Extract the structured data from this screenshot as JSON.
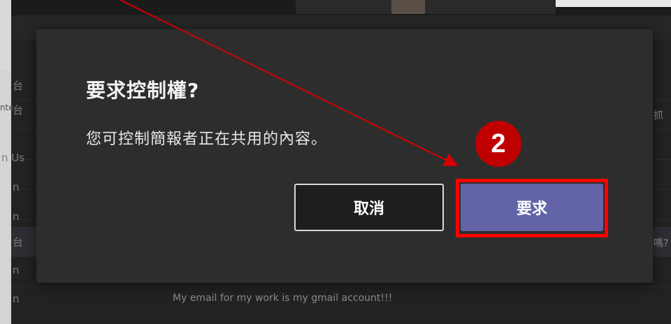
{
  "background": {
    "sidebar_fragments": [
      "台",
      "台",
      "n Us",
      "n",
      "n",
      "台",
      "n",
      "n"
    ],
    "left_input_fragment": "nte",
    "right_fragments": [
      "抓",
      "嗎?"
    ],
    "chat_message": "My email for my work is my gmail account!!!"
  },
  "dialog": {
    "title": "要求控制權?",
    "body": "您可控制簡報者正在共用的內容。",
    "cancel_label": "取消",
    "request_label": "要求"
  },
  "annotation": {
    "step_number": "2",
    "highlight_color": "#ff0000",
    "badge_color": "#c00000",
    "arrow_color": "#d40000"
  },
  "colors": {
    "dialog_bg": "#2d2d2d",
    "primary_button": "#6264a7",
    "secondary_button": "#1e1e1e"
  }
}
